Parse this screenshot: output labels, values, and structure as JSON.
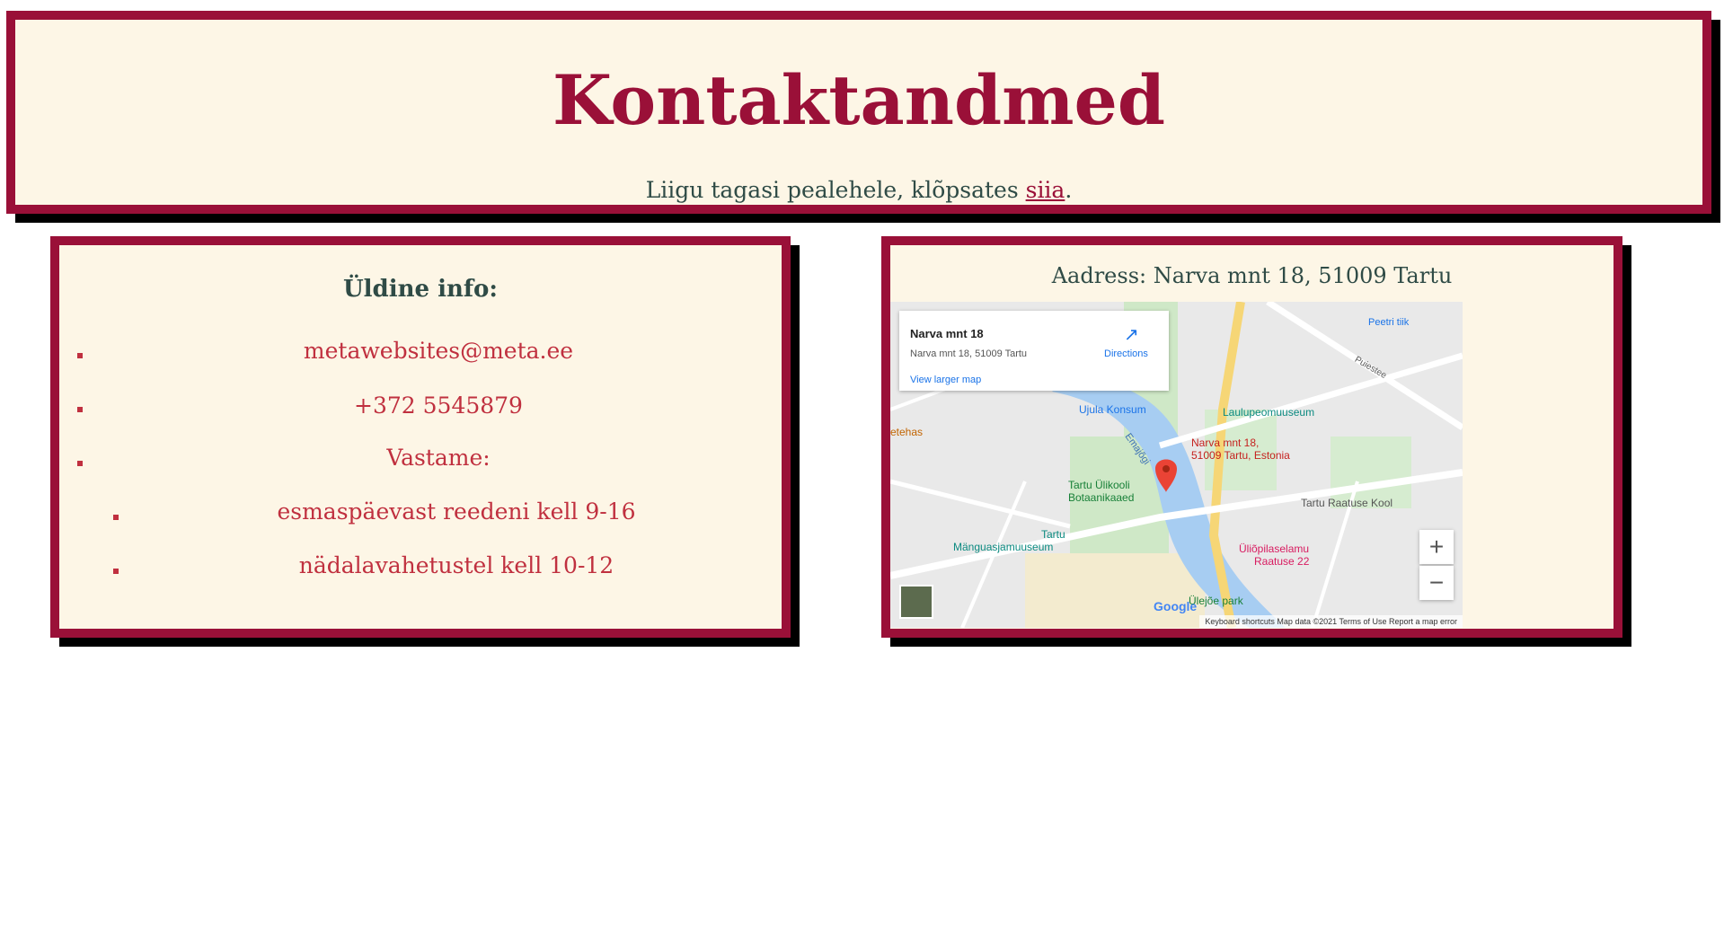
{
  "header": {
    "title": "Kontaktandmed",
    "back_text": "Liigu tagasi pealehele, klõpsates ",
    "back_link": "siia",
    "back_end": "."
  },
  "info": {
    "heading": "Üldine info:",
    "email": "metawebsites@meta.ee",
    "phone": "+372 5545879",
    "hours_label": "Vastame:",
    "hours": [
      "esmaspäevast reedeni kell 9-16",
      "nädalavahetustel kell 10-12"
    ]
  },
  "map_section": {
    "address_line": "Aadress: Narva mnt 18, 51009 Tartu",
    "card": {
      "place_name": "Narva mnt 18",
      "place_address": "Narva mnt 18, 51009 Tartu",
      "directions": "Directions",
      "larger_map": "View larger map"
    },
    "labels": {
      "ujula": "Ujula Konsum",
      "laulupeo": "Laulupeomuuseum",
      "pin_label_1": "Narva mnt 18,",
      "pin_label_2": "51009 Tartu, Estonia",
      "botaanika_1": "Tartu Ülikooli",
      "botaanika_2": "Botaanikaaed",
      "raatuse_kool": "Tartu Raatuse Kool",
      "manguasja_1": "Tartu",
      "manguasja_2": "Mänguasjamuuseum",
      "yliopilase_1": "Üliõpilaselamu",
      "yliopilase_2": "Raatuse 22",
      "peetri": "Peetri tiik",
      "puiestee": "Puiestee",
      "emajogi": "Emajõgi",
      "ulejoe": "Ülejõe park",
      "tehas": "etehas"
    },
    "footer": "Keyboard shortcuts   Map data ©2021   Terms of Use   Report a map error",
    "google": "Google",
    "zoom_in": "+",
    "zoom_out": "−"
  },
  "colors": {
    "accent": "#9a1038",
    "panel_bg": "#fdf6e6",
    "text_dark": "#2f4b46",
    "text_red": "#c0303f"
  }
}
